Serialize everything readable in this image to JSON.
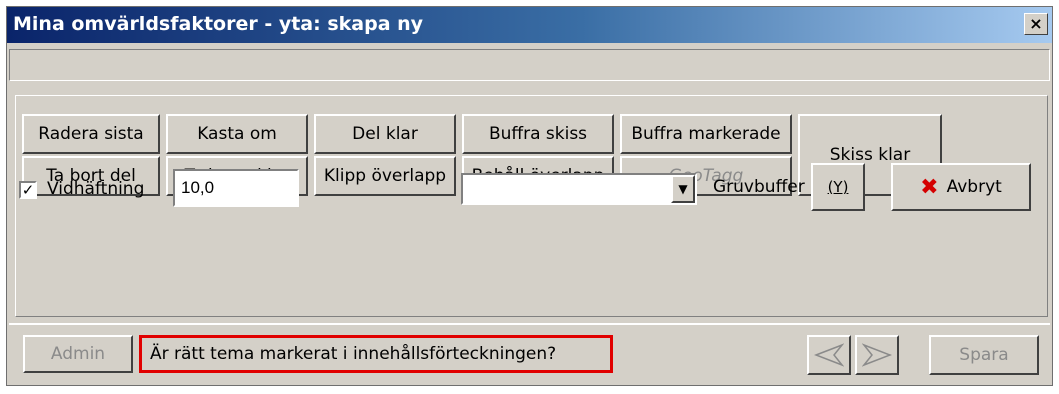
{
  "window": {
    "title": "Mina omvärldsfaktorer - yta: skapa ny",
    "close_label": "×",
    "status_text": ""
  },
  "toolbar": {
    "row1": [
      "Radera sista",
      "Kasta om",
      "Del klar",
      "Buffra skiss",
      "Buffra markerade"
    ],
    "row2": [
      "Ta bort del",
      "Ta bort skiss",
      "Klipp överlapp",
      "Behåll överlapp",
      "GeoTagg"
    ],
    "sketch_done": "Skiss klar"
  },
  "snapping": {
    "checked": true,
    "check_mark": "✓",
    "label": "Vidhäftning",
    "value": "10,0"
  },
  "dropdown": {
    "selected": "",
    "arrow": "▼"
  },
  "gruvbuffer": {
    "label": "Gruvbuffer",
    "icon_text": "(Y)"
  },
  "cancel": {
    "icon": "✖",
    "label": "Avbryt"
  },
  "bottom": {
    "admin_label": "Admin",
    "message": "Är rätt tema markerat i innehållsförteckningen?",
    "save_label": "Spara"
  },
  "colors": {
    "face": "#d4d0c8",
    "title_start": "#0a246a",
    "title_end": "#a6caf0",
    "highlight_border": "#e10000",
    "cancel_icon": "#d40000"
  }
}
